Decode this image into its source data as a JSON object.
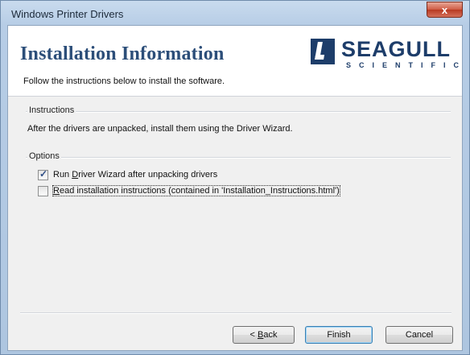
{
  "window": {
    "title": "Windows Printer Drivers",
    "close_label": "x"
  },
  "header": {
    "title": "Installation Information",
    "subtitle": "Follow the instructions below to install the software.",
    "logo": {
      "word": "SEAGULL",
      "sub": "SCIENTIFIC"
    }
  },
  "instructions": {
    "group_label": "Instructions",
    "text": "After the drivers are unpacked, install them using the Driver Wizard."
  },
  "options": {
    "group_label": "Options",
    "items": [
      {
        "pre": "Run ",
        "accel": "D",
        "post": "river Wizard after unpacking drivers",
        "checked": true
      },
      {
        "pre": "",
        "accel": "R",
        "post": "ead installation instructions (contained in 'Installation_Instructions.html')",
        "checked": false
      }
    ]
  },
  "buttons": {
    "back_pre": "< ",
    "back_accel": "B",
    "back_post": "ack",
    "finish": "Finish",
    "cancel": "Cancel"
  },
  "colors": {
    "header_title": "#2c4e79",
    "logo": "#1d3d6a",
    "close_button": "#cf5b44"
  }
}
